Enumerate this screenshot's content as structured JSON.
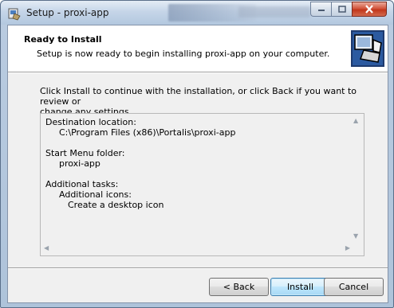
{
  "window": {
    "title": "Setup - proxi-app"
  },
  "header": {
    "title": "Ready to Install",
    "subtitle": "Setup is now ready to begin installing proxi-app on your computer."
  },
  "body": {
    "intro_line1": "Click Install to continue with the installation, or click Back if you want to review or",
    "intro_line2": "change any settings."
  },
  "summary": {
    "dest_label": "Destination location:",
    "dest_value": "C:\\Program Files (x86)\\Portalis\\proxi-app",
    "start_menu_label": "Start Menu folder:",
    "start_menu_value": "proxi-app",
    "tasks_label": "Additional tasks:",
    "tasks_group": "Additional icons:",
    "tasks_item": "Create a desktop icon"
  },
  "buttons": {
    "back": "< Back",
    "install": "Install",
    "cancel": "Cancel"
  },
  "icons": {
    "title": "setup-icon",
    "logo": "computer-box-icon",
    "minimize": "minimize-icon",
    "maximize": "maximize-icon",
    "close": "close-icon"
  },
  "colors": {
    "close_button": "#c1371b",
    "default_button_border": "#3c7fb1"
  }
}
